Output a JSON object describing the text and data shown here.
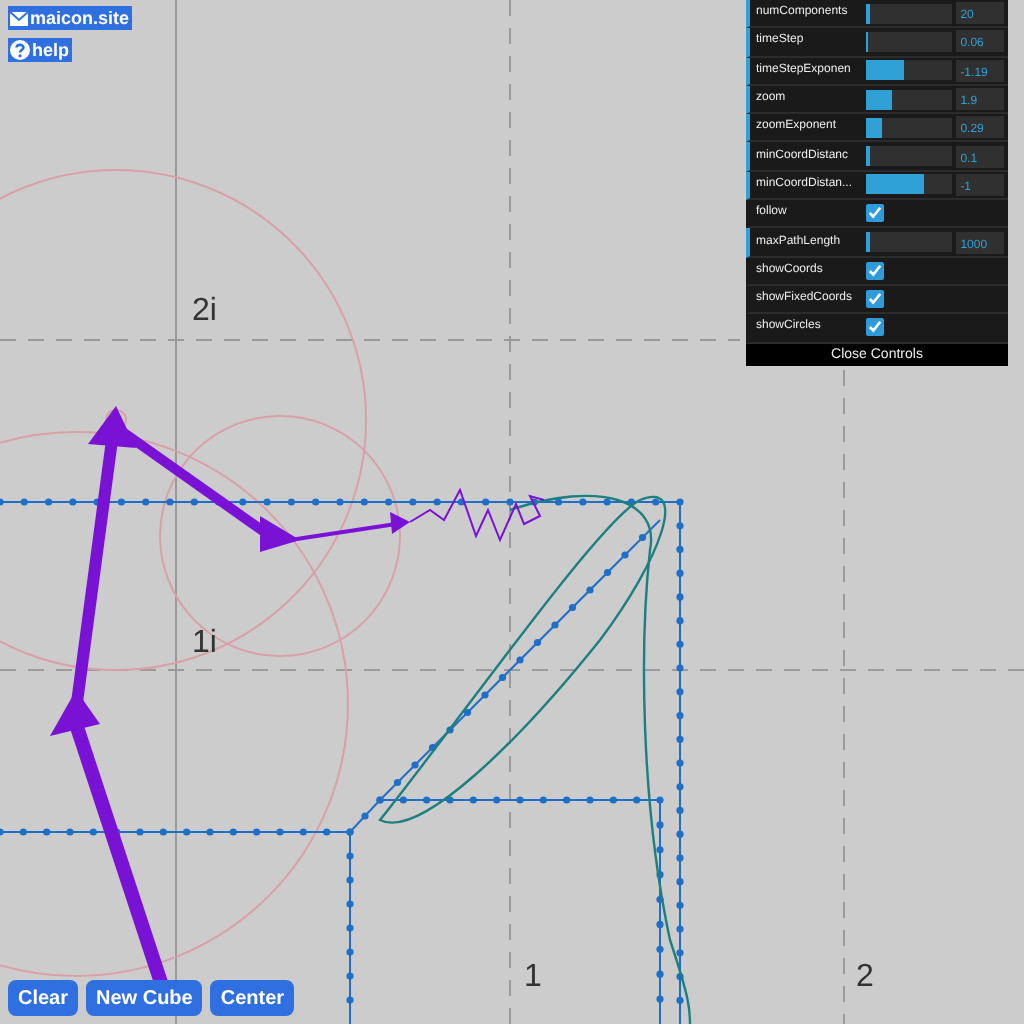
{
  "links": [
    {
      "label": "maicon.site"
    },
    {
      "label": "help"
    }
  ],
  "axis_labels": [
    "2i",
    "1i",
    "1",
    "2"
  ],
  "controls": [
    {
      "kind": "slider",
      "label": "numComponents",
      "level": 0.05,
      "value": "20"
    },
    {
      "kind": "slider",
      "label": "timeStep",
      "level": 0.02,
      "value": "0.06"
    },
    {
      "kind": "slider",
      "label": "timeStepExponen",
      "level": 0.45,
      "value": "-1.19"
    },
    {
      "kind": "slider",
      "label": "zoom",
      "level": 0.3,
      "value": "1.9"
    },
    {
      "kind": "slider",
      "label": "zoomExponent",
      "level": 0.2,
      "value": "0.29"
    },
    {
      "kind": "slider",
      "label": "minCoordDistanc",
      "level": 0.06,
      "value": "0.1"
    },
    {
      "kind": "slider",
      "label": "minCoordDistan...",
      "level": 0.68,
      "value": "-1"
    },
    {
      "kind": "checkbox",
      "label": "follow",
      "checked": true
    },
    {
      "kind": "slider",
      "label": "maxPathLength",
      "level": 0.06,
      "value": "1000"
    },
    {
      "kind": "checkbox",
      "label": "showCoords",
      "checked": true
    },
    {
      "kind": "checkbox",
      "label": "showFixedCoords",
      "checked": true
    },
    {
      "kind": "checkbox",
      "label": "showCircles",
      "checked": true
    }
  ],
  "close_label": "Close Controls",
  "buttons": [
    "Clear",
    "New Cube",
    "Center"
  ]
}
